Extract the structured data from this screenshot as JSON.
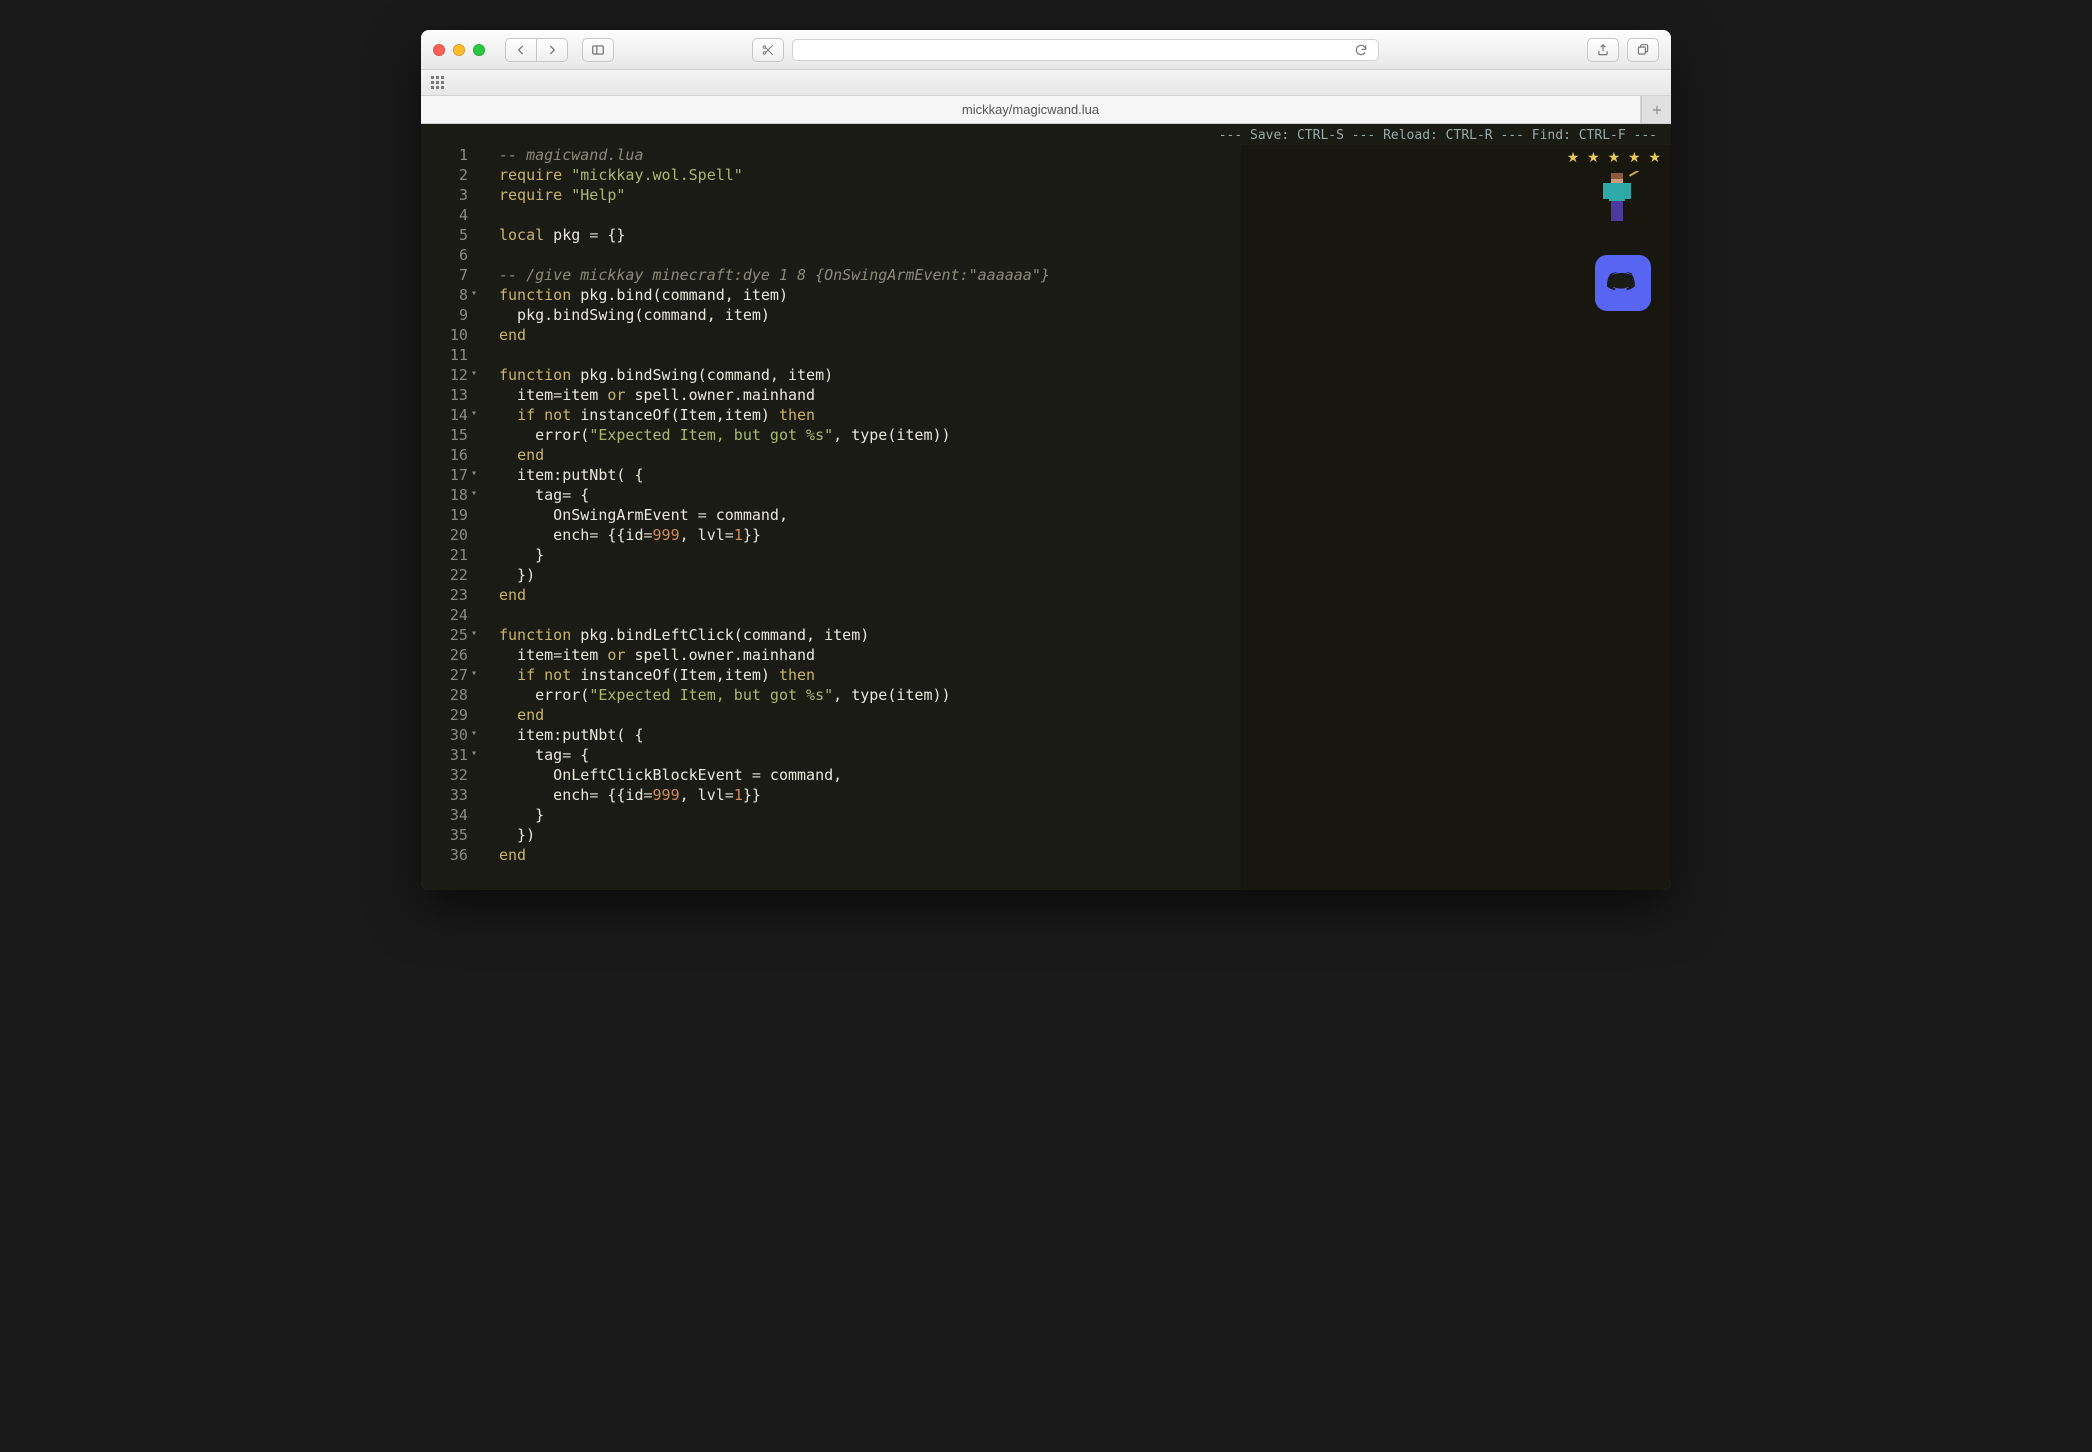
{
  "tab": {
    "title": "mickkay/magicwand.lua"
  },
  "hint": "--- Save: CTRL-S --- Reload: CTRL-R --- Find: CTRL-F ---",
  "code": {
    "lines": [
      {
        "n": 1,
        "fold": false,
        "tokens": [
          [
            "cm",
            "-- magicwand.lua"
          ]
        ]
      },
      {
        "n": 2,
        "fold": false,
        "tokens": [
          [
            "kw",
            "require"
          ],
          [
            "pn",
            " "
          ],
          [
            "str",
            "\"mickkay.wol.Spell\""
          ]
        ]
      },
      {
        "n": 3,
        "fold": false,
        "tokens": [
          [
            "kw",
            "require"
          ],
          [
            "pn",
            " "
          ],
          [
            "str",
            "\"Help\""
          ]
        ]
      },
      {
        "n": 4,
        "fold": false,
        "tokens": []
      },
      {
        "n": 5,
        "fold": false,
        "tokens": [
          [
            "kw",
            "local"
          ],
          [
            "pn",
            " pkg "
          ],
          [
            "op",
            "="
          ],
          [
            "pn",
            " {}"
          ]
        ]
      },
      {
        "n": 6,
        "fold": false,
        "tokens": []
      },
      {
        "n": 7,
        "fold": false,
        "tokens": [
          [
            "cm",
            "-- /give mickkay minecraft:dye 1 8 {OnSwingArmEvent:\"aaaaaa\"}"
          ]
        ]
      },
      {
        "n": 8,
        "fold": true,
        "tokens": [
          [
            "kw",
            "function"
          ],
          [
            "pn",
            " pkg.bind(command, item)"
          ]
        ]
      },
      {
        "n": 9,
        "fold": false,
        "tokens": [
          [
            "pn",
            "  pkg.bindSwing(command, item)"
          ]
        ]
      },
      {
        "n": 10,
        "fold": false,
        "tokens": [
          [
            "kw",
            "end"
          ]
        ]
      },
      {
        "n": 11,
        "fold": false,
        "tokens": []
      },
      {
        "n": 12,
        "fold": true,
        "tokens": [
          [
            "kw",
            "function"
          ],
          [
            "pn",
            " pkg.bindSwing(command, item)"
          ]
        ]
      },
      {
        "n": 13,
        "fold": false,
        "tokens": [
          [
            "pn",
            "  item"
          ],
          [
            "op",
            "="
          ],
          [
            "pn",
            "item "
          ],
          [
            "kw",
            "or"
          ],
          [
            "pn",
            " spell.owner.mainhand"
          ]
        ]
      },
      {
        "n": 14,
        "fold": true,
        "tokens": [
          [
            "pn",
            "  "
          ],
          [
            "kw",
            "if"
          ],
          [
            "pn",
            " "
          ],
          [
            "kw",
            "not"
          ],
          [
            "pn",
            " instanceOf(Item,item) "
          ],
          [
            "kw",
            "then"
          ]
        ]
      },
      {
        "n": 15,
        "fold": false,
        "tokens": [
          [
            "pn",
            "    error("
          ],
          [
            "str",
            "\"Expected Item, but got %s\""
          ],
          [
            "pn",
            ", type(item))"
          ]
        ]
      },
      {
        "n": 16,
        "fold": false,
        "tokens": [
          [
            "pn",
            "  "
          ],
          [
            "kw",
            "end"
          ]
        ]
      },
      {
        "n": 17,
        "fold": true,
        "tokens": [
          [
            "pn",
            "  item:putNbt( {"
          ]
        ]
      },
      {
        "n": 18,
        "fold": true,
        "tokens": [
          [
            "pn",
            "    tag"
          ],
          [
            "op",
            "="
          ],
          [
            "pn",
            " {"
          ]
        ]
      },
      {
        "n": 19,
        "fold": false,
        "tokens": [
          [
            "pn",
            "      OnSwingArmEvent "
          ],
          [
            "op",
            "="
          ],
          [
            "pn",
            " command,"
          ]
        ]
      },
      {
        "n": 20,
        "fold": false,
        "tokens": [
          [
            "pn",
            "      ench"
          ],
          [
            "op",
            "="
          ],
          [
            "pn",
            " {{id"
          ],
          [
            "op",
            "="
          ],
          [
            "num",
            "999"
          ],
          [
            "pn",
            ", lvl"
          ],
          [
            "op",
            "="
          ],
          [
            "num",
            "1"
          ],
          [
            "pn",
            "}}"
          ]
        ]
      },
      {
        "n": 21,
        "fold": false,
        "tokens": [
          [
            "pn",
            "    }"
          ]
        ]
      },
      {
        "n": 22,
        "fold": false,
        "tokens": [
          [
            "pn",
            "  })"
          ]
        ]
      },
      {
        "n": 23,
        "fold": false,
        "tokens": [
          [
            "kw",
            "end"
          ]
        ]
      },
      {
        "n": 24,
        "fold": false,
        "tokens": []
      },
      {
        "n": 25,
        "fold": true,
        "tokens": [
          [
            "kw",
            "function"
          ],
          [
            "pn",
            " pkg.bindLeftClick(command, item)"
          ]
        ]
      },
      {
        "n": 26,
        "fold": false,
        "tokens": [
          [
            "pn",
            "  item"
          ],
          [
            "op",
            "="
          ],
          [
            "pn",
            "item "
          ],
          [
            "kw",
            "or"
          ],
          [
            "pn",
            " spell.owner.mainhand"
          ]
        ]
      },
      {
        "n": 27,
        "fold": true,
        "tokens": [
          [
            "pn",
            "  "
          ],
          [
            "kw",
            "if"
          ],
          [
            "pn",
            " "
          ],
          [
            "kw",
            "not"
          ],
          [
            "pn",
            " instanceOf(Item,item) "
          ],
          [
            "kw",
            "then"
          ]
        ]
      },
      {
        "n": 28,
        "fold": false,
        "tokens": [
          [
            "pn",
            "    error("
          ],
          [
            "str",
            "\"Expected Item, but got %s\""
          ],
          [
            "pn",
            ", type(item))"
          ]
        ]
      },
      {
        "n": 29,
        "fold": false,
        "tokens": [
          [
            "pn",
            "  "
          ],
          [
            "kw",
            "end"
          ]
        ]
      },
      {
        "n": 30,
        "fold": true,
        "tokens": [
          [
            "pn",
            "  item:putNbt( {"
          ]
        ]
      },
      {
        "n": 31,
        "fold": true,
        "tokens": [
          [
            "pn",
            "    tag"
          ],
          [
            "op",
            "="
          ],
          [
            "pn",
            " {"
          ]
        ]
      },
      {
        "n": 32,
        "fold": false,
        "tokens": [
          [
            "pn",
            "      OnLeftClickBlockEvent "
          ],
          [
            "op",
            "="
          ],
          [
            "pn",
            " command,"
          ]
        ]
      },
      {
        "n": 33,
        "fold": false,
        "tokens": [
          [
            "pn",
            "      ench"
          ],
          [
            "op",
            "="
          ],
          [
            "pn",
            " {{id"
          ],
          [
            "op",
            "="
          ],
          [
            "num",
            "999"
          ],
          [
            "pn",
            ", lvl"
          ],
          [
            "op",
            "="
          ],
          [
            "num",
            "1"
          ],
          [
            "pn",
            "}}"
          ]
        ]
      },
      {
        "n": 34,
        "fold": false,
        "tokens": [
          [
            "pn",
            "    }"
          ]
        ]
      },
      {
        "n": 35,
        "fold": false,
        "tokens": [
          [
            "pn",
            "  })"
          ]
        ]
      },
      {
        "n": 36,
        "fold": false,
        "tokens": [
          [
            "kw",
            "end"
          ]
        ]
      }
    ]
  }
}
